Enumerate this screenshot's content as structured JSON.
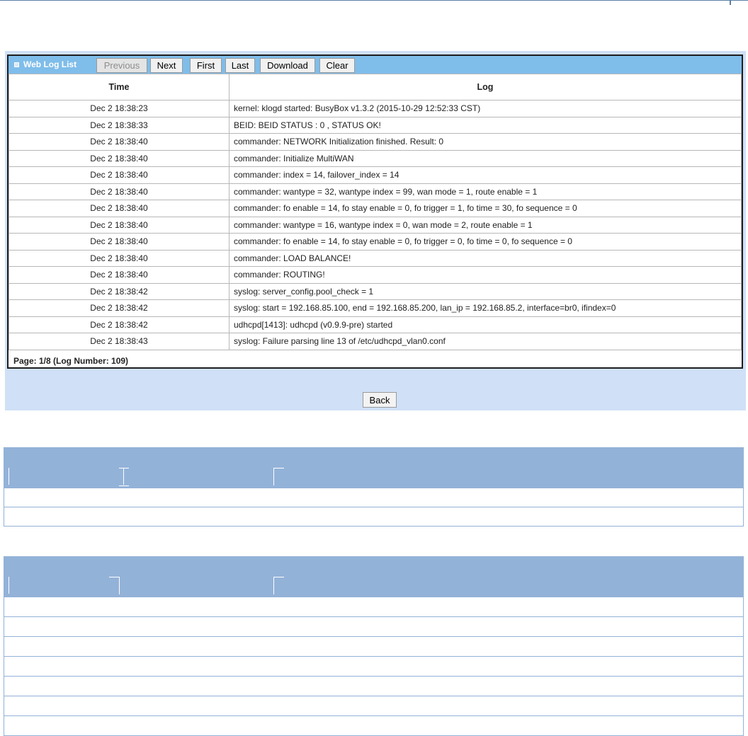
{
  "panel": {
    "title": "Web Log List",
    "buttons": {
      "previous": "Previous",
      "next": "Next",
      "first": "First",
      "last": "Last",
      "download": "Download",
      "clear": "Clear"
    },
    "columns": [
      "Time",
      "Log"
    ],
    "rows": [
      {
        "time": "Dec 2 18:38:23",
        "log": "kernel: klogd started: BusyBox v1.3.2 (2015-10-29 12:52:33 CST)"
      },
      {
        "time": "Dec 2 18:38:33",
        "log": "BEID: BEID STATUS : 0 , STATUS OK!"
      },
      {
        "time": "Dec 2 18:38:40",
        "log": "commander: NETWORK Initialization finished. Result: 0"
      },
      {
        "time": "Dec 2 18:38:40",
        "log": "commander: Initialize MultiWAN"
      },
      {
        "time": "Dec 2 18:38:40",
        "log": "commander: index = 14, failover_index = 14"
      },
      {
        "time": "Dec 2 18:38:40",
        "log": "commander: wantype = 32, wantype index = 99, wan mode = 1, route enable = 1"
      },
      {
        "time": "Dec 2 18:38:40",
        "log": "commander: fo enable = 14, fo stay enable = 0, fo trigger = 1, fo time = 30, fo sequence = 0"
      },
      {
        "time": "Dec 2 18:38:40",
        "log": "commander: wantype = 16, wantype index = 0, wan mode = 2, route enable = 1"
      },
      {
        "time": "Dec 2 18:38:40",
        "log": "commander: fo enable = 14, fo stay enable = 0, fo trigger = 0, fo time = 0, fo sequence = 0"
      },
      {
        "time": "Dec 2 18:38:40",
        "log": "commander: LOAD BALANCE!"
      },
      {
        "time": "Dec 2 18:38:40",
        "log": "commander: ROUTING!"
      },
      {
        "time": "Dec 2 18:38:42",
        "log": "syslog: server_config.pool_check = 1"
      },
      {
        "time": "Dec 2 18:38:42",
        "log": "syslog: start = 192.168.85.100, end = 192.168.85.200, lan_ip = 192.168.85.2, interface=br0, ifindex=0"
      },
      {
        "time": "Dec 2 18:38:42",
        "log": "udhcpd[1413]: udhcpd (v0.9.9-pre) started"
      },
      {
        "time": "Dec 2 18:38:43",
        "log": "syslog: Failure parsing line 13 of /etc/udhcpd_vlan0.conf"
      }
    ],
    "footer": "Page: 1/8 (Log Number: 109)",
    "back_label": "Back"
  },
  "colors": {
    "panel_bg": "#cfe0f7",
    "title_bar": "#7fbdea",
    "table_header": "#93b2d8",
    "border": "#1e1e1e"
  }
}
